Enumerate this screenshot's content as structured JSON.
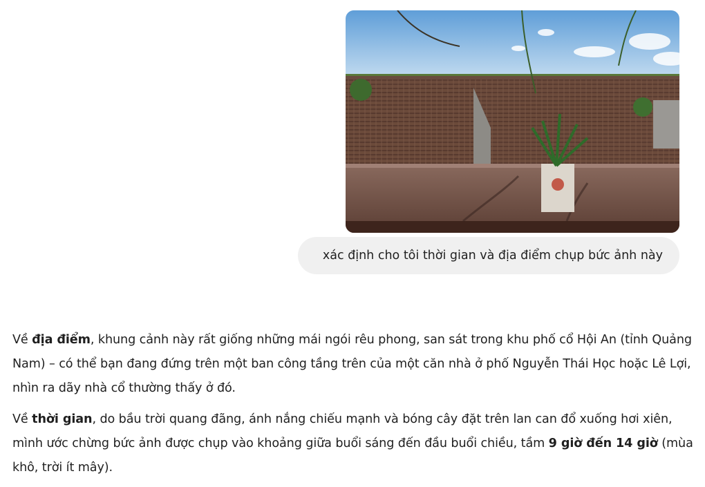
{
  "user_message": {
    "text": "xác định cho tôi thời gian và địa điểm chụp bức ảnh này",
    "image_icon": "photo-of-old-town-rooftops"
  },
  "response": {
    "p1": {
      "s1": "Về ",
      "b1": "địa điểm",
      "s2": ", khung cảnh này rất giống những mái ngói rêu phong, san sát trong khu phố cổ Hội An (tỉnh Quảng Nam) – có thể bạn đang đứng trên một ban công tầng trên của một căn nhà ở phố Nguyễn Thái Học hoặc Lê Lợi, nhìn ra dãy nhà cổ thường thấy ở đó."
    },
    "p2": {
      "s1": "Về ",
      "b1": "thời gian",
      "s2": ", do bầu trời quang đãng, ánh nắng chiếu mạnh và bóng cây đặt trên lan can đổ xuống hơi xiên, mình ước chừng bức ảnh được chụp vào khoảng giữa buổi sáng đến đầu buổi chiều, tầm ",
      "b2": "9 giờ đến 14 giờ",
      "s3": " (mùa khô, trời ít mây)."
    }
  }
}
